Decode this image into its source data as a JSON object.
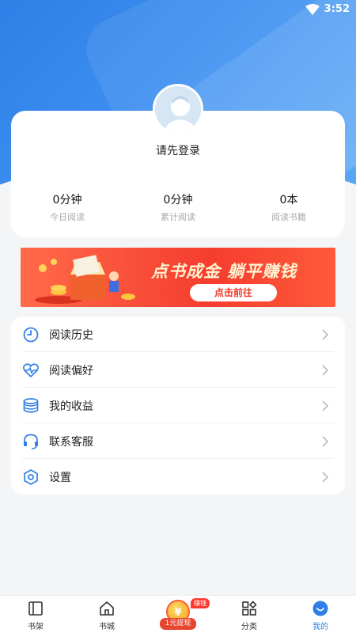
{
  "status_bar": {
    "time": "3:52"
  },
  "profile": {
    "login_prompt": "请先登录",
    "stats": [
      {
        "value": "0分钟",
        "label": "今日阅读"
      },
      {
        "value": "0分钟",
        "label": "累计阅读"
      },
      {
        "value": "0本",
        "label": "阅读书籍"
      }
    ]
  },
  "banner": {
    "title": "点书成金 躺平赚钱",
    "cta": "点击前往"
  },
  "menu": [
    {
      "label": "阅读历史",
      "icon": "clock-icon"
    },
    {
      "label": "阅读偏好",
      "icon": "heart-pulse-icon"
    },
    {
      "label": "我的收益",
      "icon": "coins-stack-icon"
    },
    {
      "label": "联系客服",
      "icon": "headset-icon"
    },
    {
      "label": "设置",
      "icon": "hexagon-settings-icon"
    }
  ],
  "tabbar": {
    "tabs": [
      {
        "label": "书架",
        "icon": "book-icon"
      },
      {
        "label": "书城",
        "icon": "home-icon"
      },
      {
        "label": "1元提现",
        "icon": "coin-icon",
        "badge": "赚钱"
      },
      {
        "label": "分类",
        "icon": "category-grid-icon"
      },
      {
        "label": "我的",
        "icon": "profile-icon"
      }
    ],
    "active": "我的"
  },
  "colors": {
    "accent": "#2f7fe6",
    "banner": "#f53d2e"
  }
}
